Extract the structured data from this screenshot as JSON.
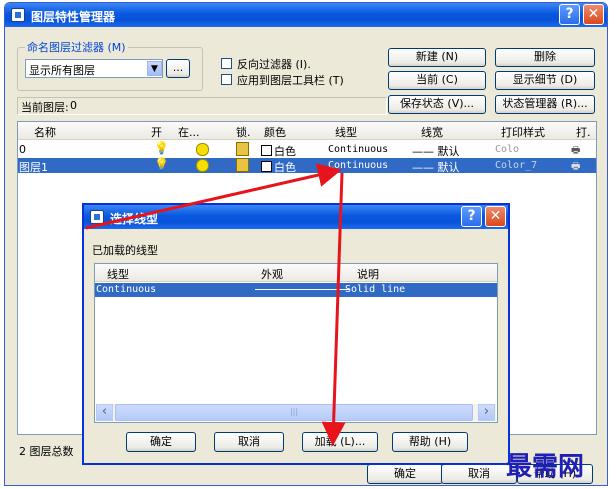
{
  "main": {
    "title": "图层特性管理器",
    "help_btn": "?",
    "close_btn": "✕",
    "filter_legend": "命名图层过滤器 (M)",
    "filter_value": "显示所有图层",
    "filter_browse": "...",
    "reverse_filter": "反向过滤器 (I).",
    "apply_toolbar": "应用到图层工具栏 (T)",
    "btn_new": "新建 (N)",
    "btn_delete": "删除",
    "btn_current": "当前 (C)",
    "btn_show_details": "显示细节 (D)",
    "btn_save_state": "保存状态 (V)...",
    "btn_state_manager": "状态管理器 (R)...",
    "current_layer_label": "当前图层:",
    "current_layer_value": "0",
    "columns": [
      "名称",
      "开",
      "在...",
      "锁.",
      "颜色",
      "线型",
      "线宽",
      "打印样式",
      "打."
    ],
    "layers": [
      {
        "name": "0",
        "color": "白色",
        "linetype": "Continuous",
        "lineweight": "—— 默认",
        "plotstyle": "Colo"
      },
      {
        "name": "图层1",
        "color": "白色",
        "linetype": "Continuous",
        "lineweight": "—— 默认",
        "plotstyle": "Color_7"
      }
    ],
    "total_label": "2 图层总数",
    "btn_ok": "确定",
    "btn_cancel": "取消",
    "btn_help": "帮助 (H)"
  },
  "dialog": {
    "title": "选择线型",
    "help_btn": "?",
    "close_btn": "✕",
    "loaded_label": "已加载的线型",
    "columns": [
      "线型",
      "外观",
      "说明"
    ],
    "rows": [
      {
        "linetype": "Continuous",
        "description": "Solid line"
      }
    ],
    "scroll_left": "‹",
    "scroll_right": "›",
    "scroll_thumb": "|||",
    "btn_ok": "确定",
    "btn_cancel": "取消",
    "btn_load": "加载 (L)...",
    "btn_help": "帮助 (H)"
  },
  "watermark": "最需网",
  "colors": {
    "arrow": "#e8141b",
    "selection": "#316ac5",
    "titlebar": "#0a58e0"
  }
}
